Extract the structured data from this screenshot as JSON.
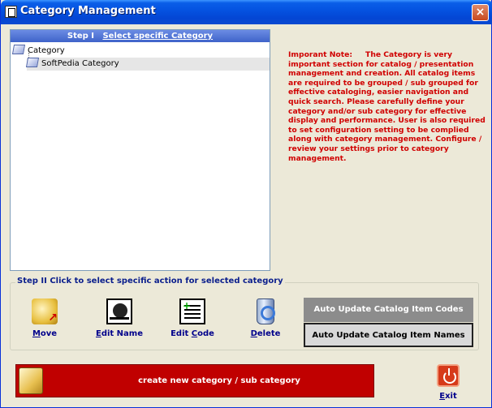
{
  "window": {
    "title": "Category Management",
    "close_label": "×"
  },
  "step1": {
    "prefix": "Step I",
    "label": "Select specific Category"
  },
  "tree": {
    "root": "Category",
    "children": [
      "SoftPedia Category"
    ]
  },
  "note": {
    "heading": "Imporant Note:",
    "body": "The Category is very important section for catalog / presentation management and creation. All catalog items are required to be grouped / sub grouped for effective cataloging, easier navigation and quick search. Please carefully define your category and/or sub category for effective display and performance. User is also required to set configuration setting to be complied along with category management. Configure / review  your settings prior to category management."
  },
  "step2": {
    "label": "Step II   Click to select specific action for selected category"
  },
  "actions": {
    "move": {
      "u": "M",
      "rest": "ove",
      "icon": "move-folder-icon"
    },
    "edit_name": {
      "pre": "",
      "u": "E",
      "rest": "dit Name",
      "icon": "edit-name-icon"
    },
    "edit_code": {
      "pre": "Edit ",
      "u": "C",
      "rest": "ode",
      "icon": "edit-code-icon"
    },
    "delete": {
      "u": "D",
      "rest": "elete",
      "icon": "recycle-bin-icon"
    }
  },
  "buttons": {
    "auto_codes": "Auto Update Catalog Item Codes",
    "auto_names": "Auto Update Catalog Item Names",
    "create": "create new category / sub category"
  },
  "exit": {
    "u": "E",
    "rest": "xit"
  },
  "colors": {
    "title_bar": "#0553e1",
    "note_text": "#d00000",
    "create_bar": "#c00000",
    "link_text": "#00008b"
  }
}
